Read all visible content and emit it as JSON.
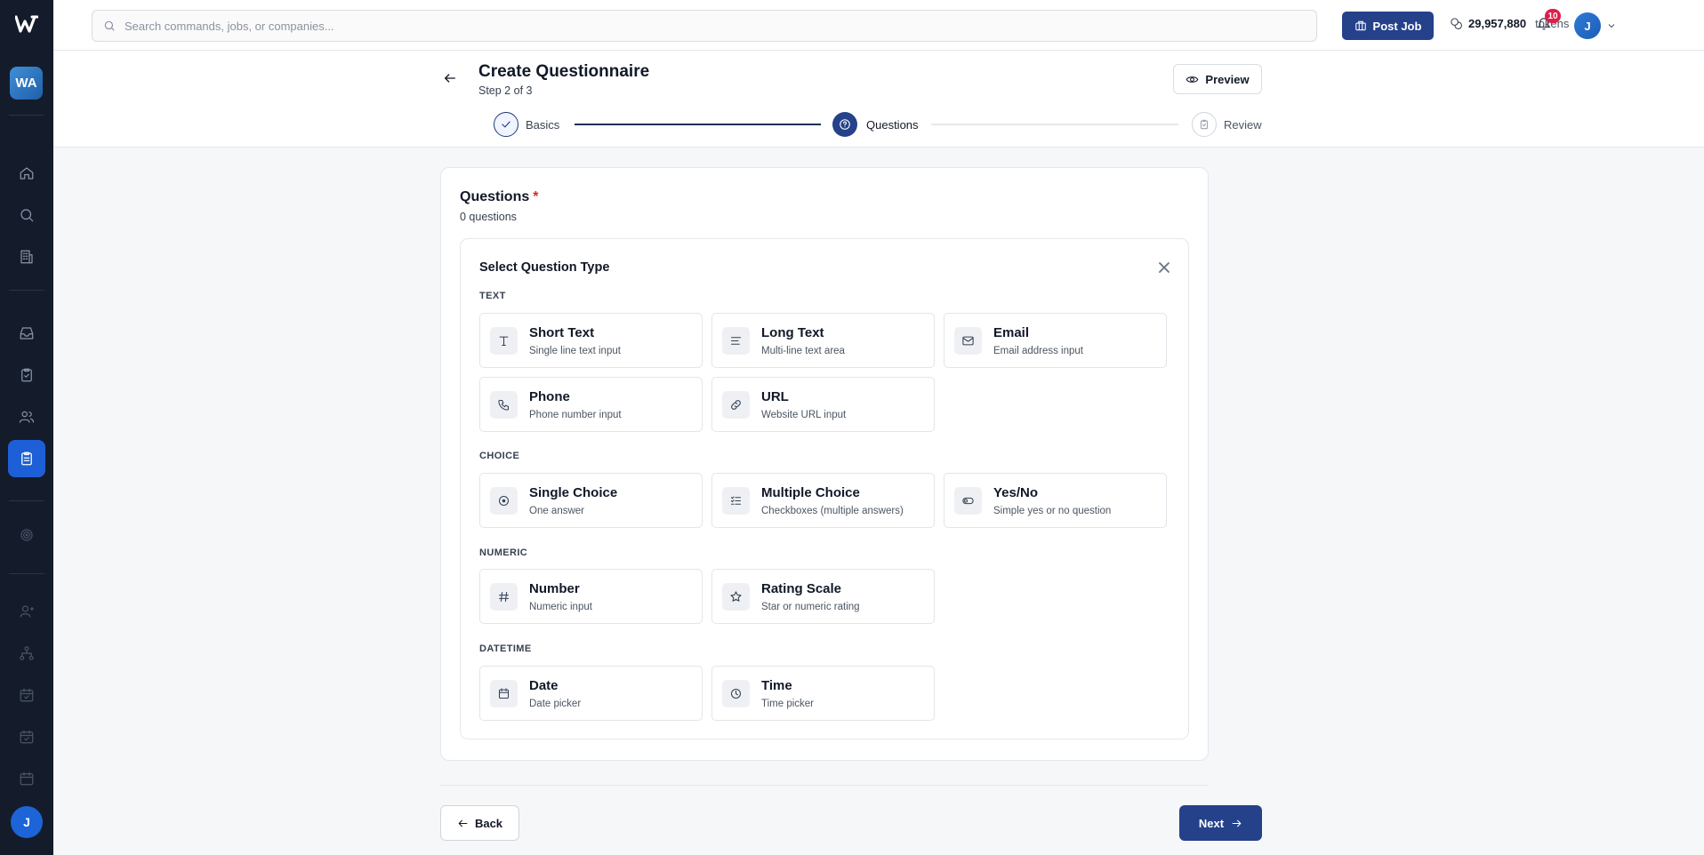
{
  "sidebar": {
    "workspace_initials": "WA",
    "user_initial": "J",
    "icons": [
      "home-icon",
      "search-icon",
      "building-icon",
      "inbox-icon",
      "clipboard-check-icon",
      "users-icon",
      "questionnaire-icon",
      "target-icon",
      "user-icon",
      "org-chart-icon",
      "calendar-check-icon",
      "calendar-check-icon",
      "calendar-icon"
    ]
  },
  "topbar": {
    "search_placeholder": "Search commands, jobs, or companies...",
    "post_job_label": "Post Job",
    "tokens_value": "29,957,880",
    "tokens_label": "tokens",
    "notification_count": "10",
    "avatar_initial": "J"
  },
  "header": {
    "title": "Create Questionnaire",
    "step_text": "Step 2 of 3",
    "preview_label": "Preview"
  },
  "stepper": {
    "steps": [
      {
        "label": "Basics",
        "state": "complete"
      },
      {
        "label": "Questions",
        "state": "current"
      },
      {
        "label": "Review",
        "state": "upcoming"
      }
    ]
  },
  "questions": {
    "title": "Questions",
    "required_mark": "*",
    "count_text": "0 questions"
  },
  "picker": {
    "title": "Select Question Type",
    "sections": [
      {
        "label": "TEXT",
        "options": [
          {
            "title": "Short Text",
            "desc": "Single line text input",
            "icon": "text-t-icon"
          },
          {
            "title": "Long Text",
            "desc": "Multi-line text area",
            "icon": "align-left-icon"
          },
          {
            "title": "Email",
            "desc": "Email address input",
            "icon": "mail-icon"
          },
          {
            "title": "Phone",
            "desc": "Phone number input",
            "icon": "phone-icon"
          },
          {
            "title": "URL",
            "desc": "Website URL input",
            "icon": "link-icon"
          }
        ]
      },
      {
        "label": "CHOICE",
        "options": [
          {
            "title": "Single Choice",
            "desc": "One answer",
            "icon": "radio-icon"
          },
          {
            "title": "Multiple Choice",
            "desc": "Checkboxes (multiple answers)",
            "icon": "checklist-icon"
          },
          {
            "title": "Yes/No",
            "desc": "Simple yes or no question",
            "icon": "toggle-icon"
          }
        ]
      },
      {
        "label": "NUMERIC",
        "options": [
          {
            "title": "Number",
            "desc": "Numeric input",
            "icon": "hash-icon"
          },
          {
            "title": "Rating Scale",
            "desc": "Star or numeric rating",
            "icon": "star-icon"
          }
        ]
      },
      {
        "label": "DATETIME",
        "options": [
          {
            "title": "Date",
            "desc": "Date picker",
            "icon": "calendar-icon"
          },
          {
            "title": "Time",
            "desc": "Time picker",
            "icon": "clock-icon"
          }
        ]
      }
    ]
  },
  "footer": {
    "back_label": "Back",
    "next_label": "Next"
  },
  "colors": {
    "primary": "#24418a",
    "sidebar_bg": "#141c2b",
    "active_nav": "#1d5fd6",
    "required": "#dc2626",
    "badge": "#e11d48"
  }
}
